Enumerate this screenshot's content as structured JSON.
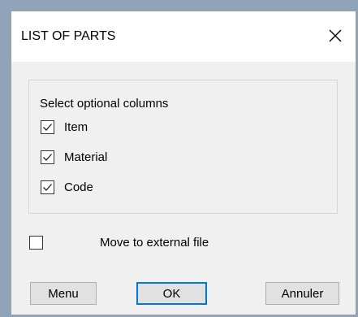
{
  "dialog": {
    "title": "LIST OF PARTS",
    "close_icon": "close-icon"
  },
  "optional_columns": {
    "caption": "Select optional columns",
    "items": [
      {
        "label": "Item",
        "checked": true
      },
      {
        "label": "Material",
        "checked": true
      },
      {
        "label": "Code",
        "checked": true
      }
    ]
  },
  "external_file": {
    "label": "Move to external file",
    "checked": false
  },
  "buttons": {
    "menu": "Menu",
    "ok": "OK",
    "cancel": "Annuler"
  },
  "colors": {
    "default_button_border": "#0078d7",
    "dialog_background": "#f0f0f0"
  }
}
